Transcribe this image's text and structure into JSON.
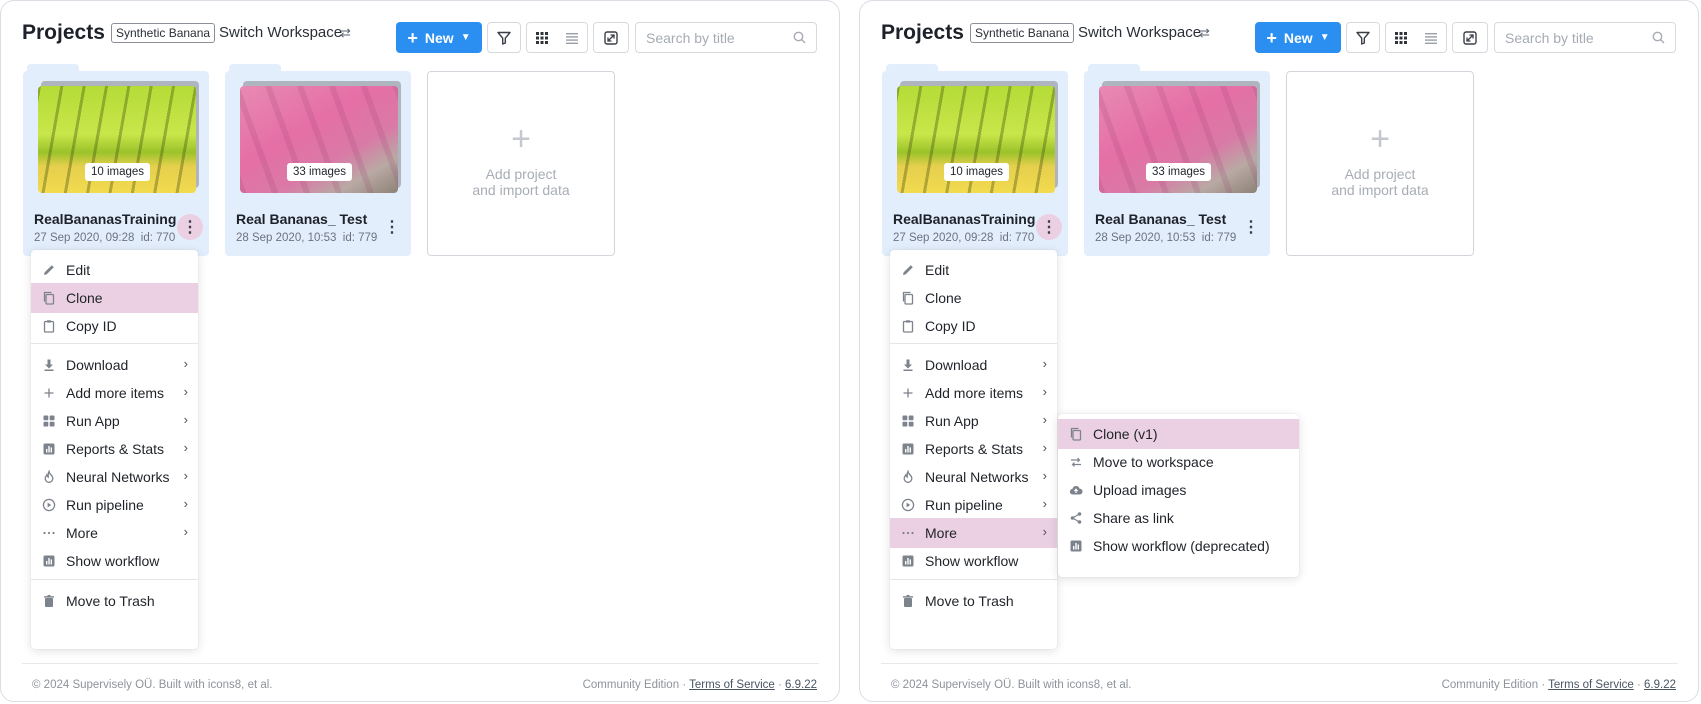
{
  "header": {
    "title": "Projects",
    "workspace_badge": "Synthetic Banana",
    "switch_label": "Switch Workspace",
    "new_label": "New",
    "search_placeholder": "Search by title"
  },
  "projects": [
    {
      "name": "RealBananasTraining",
      "date": "27 Sep 2020, 09:28",
      "id": "id: 770",
      "count": "10 images"
    },
    {
      "name": "Real Bananas_ Test",
      "date": "28 Sep 2020, 10:53",
      "id": "id: 779",
      "count": "33 images"
    }
  ],
  "add_card": {
    "line1": "Add project",
    "line2": "and import data"
  },
  "context_menu": [
    {
      "label": "Edit",
      "icon": "pencil-icon"
    },
    {
      "label": "Clone",
      "icon": "copy-icon"
    },
    {
      "label": "Copy ID",
      "icon": "clipboard-icon"
    },
    {
      "label": "Download",
      "icon": "download-icon"
    },
    {
      "label": "Add more items",
      "icon": "plus-icon"
    },
    {
      "label": "Run App",
      "icon": "apps-grid-icon"
    },
    {
      "label": "Reports & Stats",
      "icon": "chart-icon"
    },
    {
      "label": "Neural Networks",
      "icon": "flame-icon"
    },
    {
      "label": "Run pipeline",
      "icon": "play-circle-icon"
    },
    {
      "label": "More",
      "icon": "dots-icon"
    },
    {
      "label": "Show workflow",
      "icon": "chart-icon"
    },
    {
      "label": "Move to Trash",
      "icon": "trash-icon"
    }
  ],
  "more_submenu": [
    {
      "label": "Clone (v1)",
      "icon": "copy-icon"
    },
    {
      "label": "Move to workspace",
      "icon": "swap-icon"
    },
    {
      "label": "Upload images",
      "icon": "cloud-upload-icon"
    },
    {
      "label": "Share as link",
      "icon": "share-icon"
    },
    {
      "label": "Show workflow (deprecated)",
      "icon": "chart-icon"
    }
  ],
  "highlight": {
    "left_panel": "Clone",
    "right_panel_menu": "More",
    "right_panel_submenu": "Clone (v1)"
  },
  "footer": {
    "copyright": "© 2024 Supervisely OÜ. Built with icons8, et al.",
    "edition": "Community Edition",
    "dot": " · ",
    "terms": "Terms of Service",
    "version": "6.9.22"
  },
  "colors": {
    "accent": "#2a8ff0",
    "highlight": "#ead0e2",
    "card_bg": "#e3eefc"
  }
}
